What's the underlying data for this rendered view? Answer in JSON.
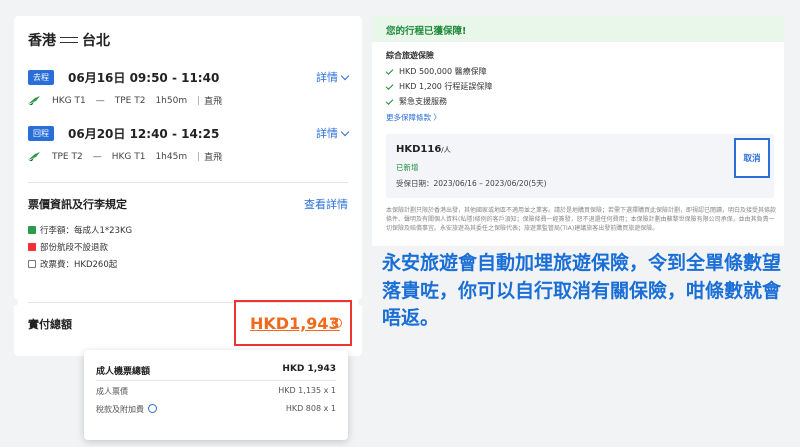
{
  "trip": {
    "route_from": "香港",
    "route_to": "台北",
    "outbound": {
      "badge": "去程",
      "datetime": "06月16日  09:50 - 11:40",
      "detail_label": "詳情",
      "from": "HKG T1",
      "sep": "—",
      "to": "TPE T2",
      "duration": "1h50m",
      "type": "直飛"
    },
    "inbound": {
      "badge": "回程",
      "datetime": "06月20日  12:40 - 14:25",
      "detail_label": "詳情",
      "from": "TPE T2",
      "sep": "—",
      "to": "HKG T1",
      "duration": "1h45m",
      "type": "直飛"
    }
  },
  "fare": {
    "title": "票價資訊及行李規定",
    "link": "查看詳情",
    "rules": [
      "行李額：每成人1*23KG",
      "部份航段不設退款",
      "改票費：HKD260起"
    ]
  },
  "total": {
    "label": "實付總額",
    "amount": "HKD1,943",
    "info": "i"
  },
  "breakdown": {
    "head_label": "成人機票總額",
    "head_value": "HKD  1,943",
    "rows": [
      {
        "label": "成人票價",
        "value": "HKD  1,135 x 1"
      },
      {
        "label": "稅款及附加費",
        "value": "HKD   808 x 1"
      }
    ]
  },
  "insurance": {
    "header": "您的行程已獲保障!",
    "subtitle": "綜合旅遊保險",
    "coverages": [
      "HKD 500,000 醫療保障",
      "HKD 1,200 行程延誤保障",
      "緊急支援服務"
    ],
    "more": "更多保障條款 〉",
    "price": "HKD116",
    "per": "/人",
    "status": "已新增",
    "dates": "受保日期：2023/06/16 – 2023/06/20(5天)",
    "cancel": "取消",
    "disclaimer": "本保險計劃只限於香港出發，其他國家或地區不適用並之業客。請於是地購買保險；若需下選擇購買此保險計劃，即視認已閱讀，明白及接受其條款條件、聲明及有關個人資料(私隱)條例的客戶須知；保險條費一經簽發，恕不退還任何費用；本保險計劃由蘇黎世保險有限公司承保，並由其負責一切保險及賠償事宜。永安旅遊為其委任之保險代表；旅遊業監管局(TIA)建議旅客出發前購買旅遊保險。"
  },
  "note": "永安旅遊會自動加埋旅遊保險，令到全單條數望落貴咗，你可以自行取消有關保險，咁條數就會唔返。",
  "colors": {
    "accent": "#2a6ed8",
    "price": "#f06a1e",
    "highlight": "#e33333",
    "green": "#1f8a3a"
  }
}
